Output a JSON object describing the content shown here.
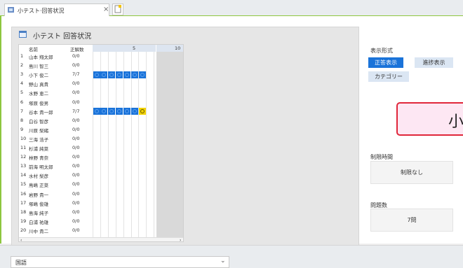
{
  "tab": {
    "title": "小テスト·回答状況",
    "close": "×"
  },
  "panel": {
    "title": "小テスト 回答状況"
  },
  "grid": {
    "headers": {
      "name": "名前",
      "score": "正解数",
      "col5": "5",
      "col10": "10"
    },
    "rows": [
      {
        "no": "1",
        "name": "山本 翔太郎",
        "score": "0/0",
        "answers": []
      },
      {
        "no": "2",
        "name": "島川 智三",
        "score": "0/0",
        "answers": []
      },
      {
        "no": "3",
        "name": "小下 俊二",
        "score": "7/7",
        "answers": [
          "c",
          "c",
          "c",
          "c",
          "c",
          "c",
          "c"
        ]
      },
      {
        "no": "4",
        "name": "野山 真貴",
        "score": "0/0",
        "answers": []
      },
      {
        "no": "5",
        "name": "水野 恵二",
        "score": "0/0",
        "answers": []
      },
      {
        "no": "6",
        "name": "塚原 俊男",
        "score": "0/0",
        "answers": []
      },
      {
        "no": "7",
        "name": "谷本 貴一郎",
        "score": "7/7",
        "answers": [
          "c",
          "c",
          "c",
          "c",
          "c",
          "c",
          "y"
        ]
      },
      {
        "no": "8",
        "name": "白谷 智彦",
        "score": "0/0",
        "answers": []
      },
      {
        "no": "9",
        "name": "川原 梨緒",
        "score": "0/0",
        "answers": []
      },
      {
        "no": "10",
        "name": "三海 浩子",
        "score": "0/0",
        "answers": []
      },
      {
        "no": "11",
        "name": "杉浦 純菜",
        "score": "0/0",
        "answers": []
      },
      {
        "no": "12",
        "name": "林野 青奈",
        "score": "0/0",
        "answers": []
      },
      {
        "no": "13",
        "name": "前海 明太郎",
        "score": "0/0",
        "answers": []
      },
      {
        "no": "14",
        "name": "水村 梨彦",
        "score": "0/0",
        "answers": []
      },
      {
        "no": "15",
        "name": "鳥嶋 正菜",
        "score": "0/0",
        "answers": []
      },
      {
        "no": "16",
        "name": "岩野 貴一",
        "score": "0/0",
        "answers": []
      },
      {
        "no": "17",
        "name": "塚嶋 俊雄",
        "score": "0/0",
        "answers": []
      },
      {
        "no": "18",
        "name": "島海 純子",
        "score": "0/0",
        "answers": []
      },
      {
        "no": "19",
        "name": "白浦 祐雄",
        "score": "0/0",
        "answers": []
      },
      {
        "no": "20",
        "name": "川中 貴二",
        "score": "0/0",
        "answers": []
      }
    ]
  },
  "display": {
    "label": "表示形式",
    "buttons": [
      "正答表示",
      "進捗表示",
      "カテゴリー"
    ],
    "active": "正答表示"
  },
  "banner": {
    "text": "小"
  },
  "time_limit": {
    "label": "制限時間",
    "value": "制限なし"
  },
  "question_count": {
    "label": "問題数",
    "value": "7問"
  },
  "subject": {
    "value": "国語",
    "chevron": "⌄"
  },
  "colors": {
    "accent": "#1a73d9",
    "frame": "#8dc63f",
    "banner_border": "#e0263a",
    "banner_fill": "#fde7f3",
    "highlight": "#f2d300"
  }
}
